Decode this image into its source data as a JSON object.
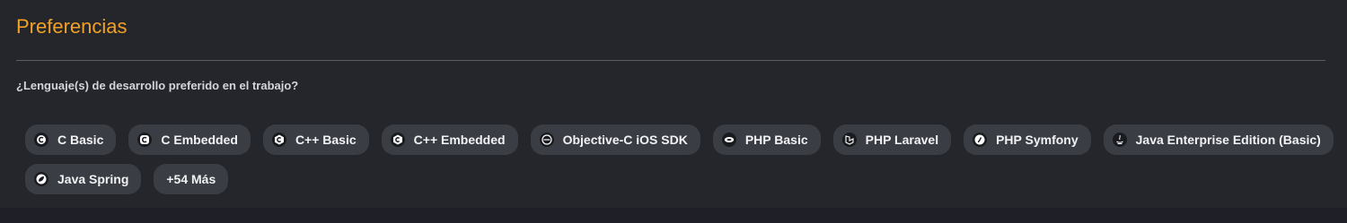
{
  "section": {
    "title": "Preferencias",
    "question": "¿Lenguaje(s) de desarrollo preferido en el trabajo?"
  },
  "languages": {
    "row1": [
      {
        "label": "C Basic",
        "icon": "c-icon"
      },
      {
        "label": "C Embedded",
        "icon": "c-icon"
      },
      {
        "label": "C++ Basic",
        "icon": "cpp-icon"
      },
      {
        "label": "C++ Embedded",
        "icon": "cpp-icon"
      },
      {
        "label": "Objective-C iOS SDK",
        "icon": "objective-c-icon"
      },
      {
        "label": "PHP Basic",
        "icon": "php-icon"
      },
      {
        "label": "PHP Laravel",
        "icon": "laravel-icon"
      },
      {
        "label": "PHP Symfony",
        "icon": "symfony-icon"
      },
      {
        "label": "Java Enterprise Edition (Basic)",
        "icon": "java-icon"
      }
    ],
    "row2": [
      {
        "label": "Java Spring",
        "icon": "spring-icon"
      }
    ],
    "more_label": "+54 Más"
  },
  "colors": {
    "accent": "#f2a125",
    "panel": "#24262b",
    "chip": "#3a3d44"
  }
}
